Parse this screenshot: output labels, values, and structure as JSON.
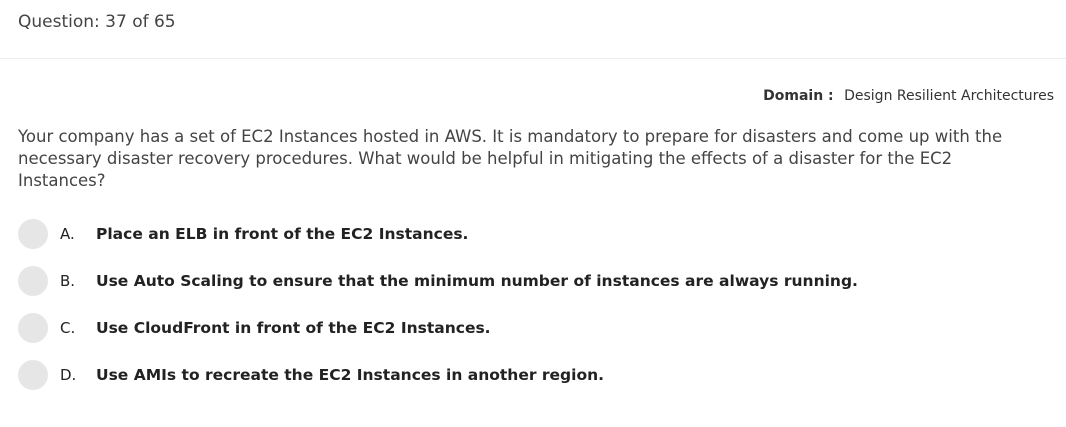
{
  "header": {
    "question_counter": "Question: 37 of 65"
  },
  "domain": {
    "label": "Domain :",
    "value": "Design Resilient Architectures"
  },
  "question": {
    "text": "Your company has a set of EC2 Instances hosted in AWS. It is mandatory to prepare for disasters and come up with the necessary disaster recovery procedures. What would be helpful in mitigating the effects of a disaster for the EC2 Instances?"
  },
  "options": [
    {
      "letter": "A.",
      "text": "Place an ELB in front of the EC2 Instances."
    },
    {
      "letter": "B.",
      "text": "Use Auto Scaling to ensure that the minimum number of instances are always running."
    },
    {
      "letter": "C.",
      "text": "Use CloudFront in front of the EC2 Instances."
    },
    {
      "letter": "D.",
      "text": "Use AMIs to recreate the EC2 Instances in another region."
    }
  ]
}
